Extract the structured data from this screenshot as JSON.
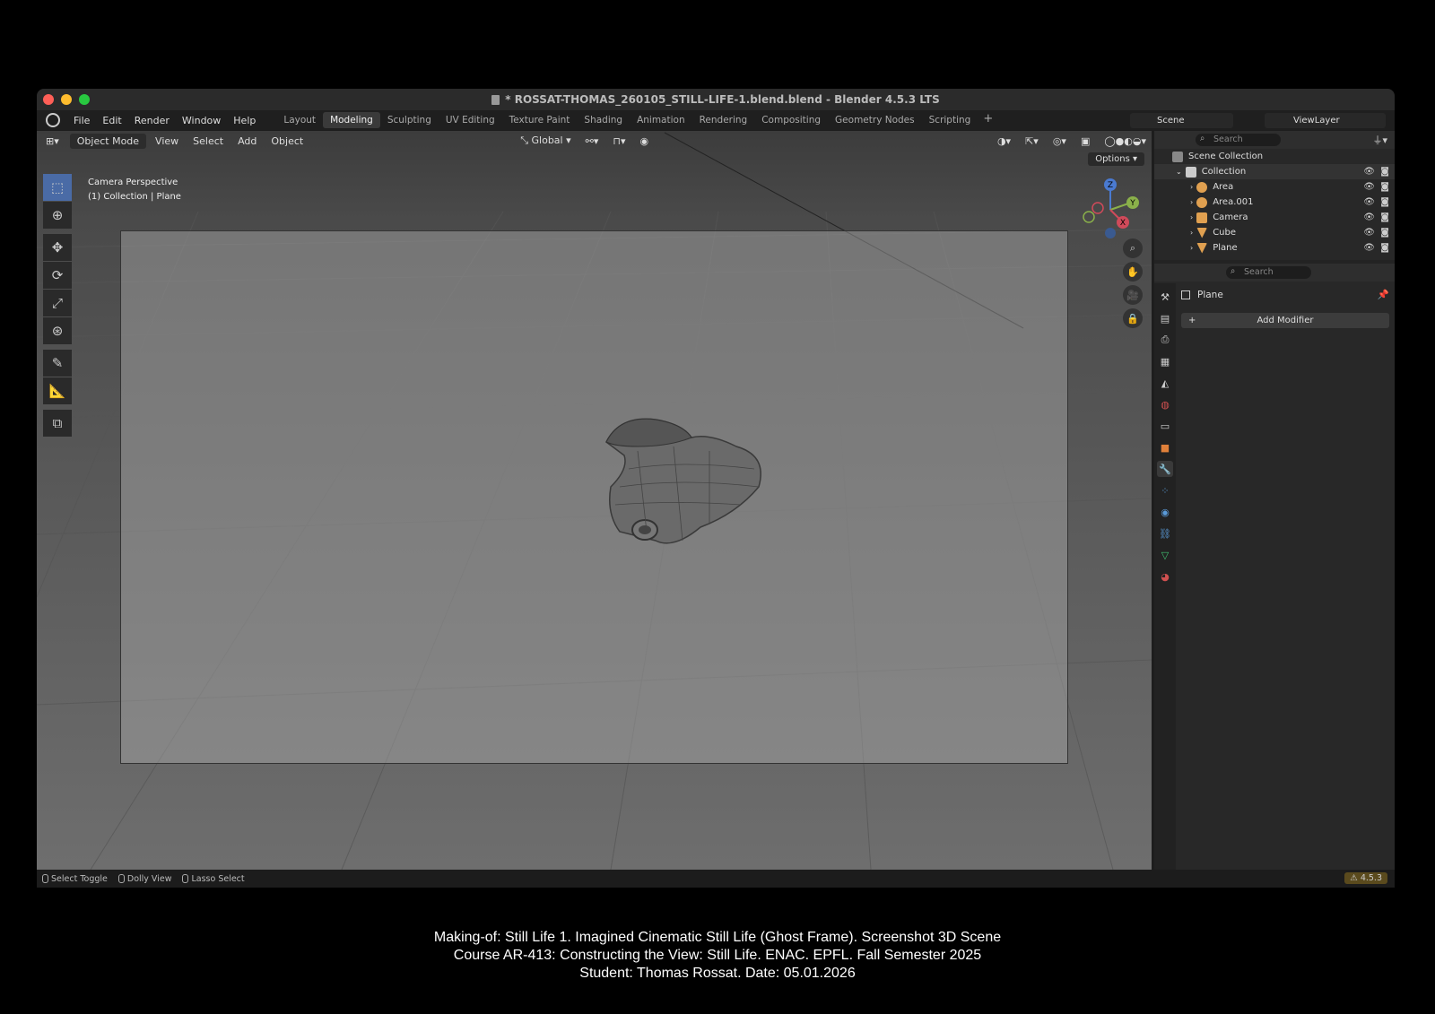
{
  "window": {
    "title": "* ROSSAT-THOMAS_260105_STILL-LIFE-1.blend.blend - Blender 4.5.3 LTS"
  },
  "menu": [
    "File",
    "Edit",
    "Render",
    "Window",
    "Help"
  ],
  "workspaces": [
    "Layout",
    "Modeling",
    "Sculpting",
    "UV Editing",
    "Texture Paint",
    "Shading",
    "Animation",
    "Rendering",
    "Compositing",
    "Geometry Nodes",
    "Scripting"
  ],
  "active_workspace": "Modeling",
  "scene_name": "Scene",
  "view_layer": "ViewLayer",
  "viewport": {
    "mode": "Object Mode",
    "menus": [
      "View",
      "Select",
      "Add",
      "Object"
    ],
    "orientation": "Global",
    "options_label": "Options",
    "info_line1": "Camera Perspective",
    "info_line2": "(1) Collection | Plane",
    "gizmo_axes": [
      "Z",
      "Y",
      "X"
    ]
  },
  "outliner": {
    "search_placeholder": "Search",
    "scene_collection": "Scene Collection",
    "collection": "Collection",
    "items": [
      {
        "name": "Area",
        "icon": "light-icon",
        "color": "#e0a050"
      },
      {
        "name": "Area.001",
        "icon": "light-icon",
        "color": "#e0a050"
      },
      {
        "name": "Camera",
        "icon": "camera-icon",
        "color": "#e0a050"
      },
      {
        "name": "Cube",
        "icon": "mesh-icon",
        "color": "#e0a050"
      },
      {
        "name": "Plane",
        "icon": "mesh-icon",
        "color": "#e0a050"
      }
    ]
  },
  "properties": {
    "search_placeholder": "Search",
    "object_name": "Plane",
    "add_modifier": "Add Modifier"
  },
  "statusbar": {
    "hints": [
      "Select Toggle",
      "Dolly View",
      "Lasso Select"
    ],
    "version": "4.5.3"
  },
  "caption": {
    "line1": "Making-of: Still Life 1. Imagined Cinematic Still Life (Ghost Frame). Screenshot 3D Scene",
    "line2": "Course AR-413: Constructing the View: Still Life. ENAC. EPFL. Fall Semester 2025",
    "line3": "Student: Thomas Rossat. Date: 05.01.2026"
  }
}
